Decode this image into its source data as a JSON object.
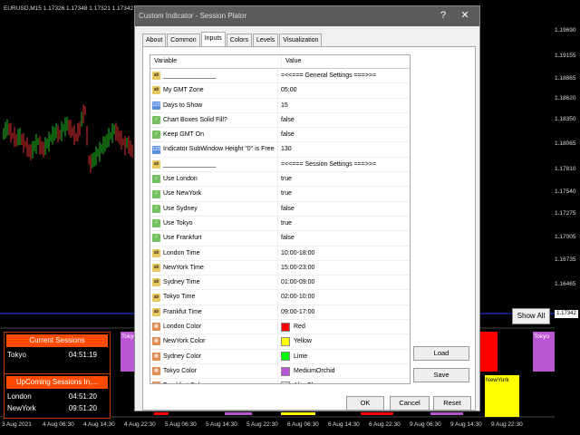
{
  "chart": {
    "symbol_info": "EURUSD,M15  1.17326 1.17348 1.17321 1.17342",
    "price_labels": [
      "1.19690",
      "1.19155",
      "1.18865",
      "1.18620",
      "1.18350",
      "1.18065",
      "1.17810",
      "1.17540",
      "1.17275",
      "1.17005",
      "1.16735",
      "1.16465"
    ],
    "current_price": "1.17342",
    "time_labels": [
      "3 Aug 2021",
      "4 Aug 06:30",
      "4 Aug 14:30",
      "4 Aug 22:30",
      "5 Aug 06:30",
      "5 Aug 14:30",
      "5 Aug 22:30",
      "6 Aug 06:30",
      "6 Aug 14:30",
      "6 Aug 22:30",
      "9 Aug 06:30",
      "9 Aug 14:30",
      "9 Aug 22:30"
    ],
    "show_all_label": "Show All",
    "tokyo_box_label": "Tokyo",
    "tokyo_box_label_right": "Tokyo",
    "newyork_box_label": "NewYork"
  },
  "sessions_panel": {
    "current_title": "Current Sessions",
    "current_rows": [
      {
        "name": "Tokyo",
        "time": "04:51:19"
      }
    ],
    "upcoming_title": "UpComing Sessions In,...",
    "upcoming_rows": [
      {
        "name": "London",
        "time": "04:51:20"
      },
      {
        "name": "NewYork",
        "time": "09:51:20"
      }
    ]
  },
  "dialog": {
    "title": "Custom Indicator - Session Plator",
    "help_btn": "?",
    "close_btn": "✕",
    "tabs": [
      "About",
      "Common",
      "Inputs",
      "Colors",
      "Levels",
      "Visualization"
    ],
    "active_tab": "Inputs",
    "columns": {
      "variable": "Variable",
      "value": "Value"
    },
    "rows": [
      {
        "icon": "ab",
        "var": "_______________",
        "val": "=<<=== General Settings ===>>="
      },
      {
        "icon": "ab",
        "var": "My GMT Zone",
        "val": "05:00"
      },
      {
        "icon": "num",
        "var": "Days to Show",
        "val": "15"
      },
      {
        "icon": "bool",
        "var": "Chart Boxes Solid Fill?",
        "val": "false"
      },
      {
        "icon": "bool",
        "var": "Keep GMT On",
        "val": "false"
      },
      {
        "icon": "num",
        "var": "Indicator SubWindow Height \"0\" is Free",
        "val": "130"
      },
      {
        "icon": "ab",
        "var": "_______________",
        "val": "=<<=== Session Settings ===>>="
      },
      {
        "icon": "bool",
        "var": "Use London",
        "val": "true"
      },
      {
        "icon": "bool",
        "var": "Use NewYork",
        "val": "true"
      },
      {
        "icon": "bool",
        "var": "Use Sydney",
        "val": "false"
      },
      {
        "icon": "bool",
        "var": "Use Tokyo",
        "val": "true"
      },
      {
        "icon": "bool",
        "var": "Use Frankfurt",
        "val": "false"
      },
      {
        "icon": "ab",
        "var": "London Time",
        "val": "10:00-18:00"
      },
      {
        "icon": "ab",
        "var": "NewYork Time",
        "val": "15:00-23:00"
      },
      {
        "icon": "ab",
        "var": "Sydney Time",
        "val": "01:00-09:00"
      },
      {
        "icon": "ab",
        "var": "Tokyo Time",
        "val": "02:00-10:00"
      },
      {
        "icon": "ab",
        "var": "Frankfut Time",
        "val": "09:00-17:00"
      },
      {
        "icon": "col",
        "var": "London Color",
        "val": "Red",
        "color": "#ff0000"
      },
      {
        "icon": "col",
        "var": "NewYork Color",
        "val": "Yellow",
        "color": "#ffff00"
      },
      {
        "icon": "col",
        "var": "Sydney Color",
        "val": "Lime",
        "color": "#00ff00"
      },
      {
        "icon": "col",
        "var": "Tokyo Color",
        "val": "MediumOrchid",
        "color": "#ba55d3"
      },
      {
        "icon": "col",
        "var": "Frankfurt Color",
        "val": "AliceBlue",
        "color": "#f0f8ff"
      }
    ],
    "icon_text": {
      "ab": "ab",
      "num": "123",
      "bool": "✓",
      "col": "▦"
    },
    "load_btn": "Load",
    "save_btn": "Save",
    "ok_btn": "OK",
    "cancel_btn": "Cancel",
    "reset_btn": "Reset"
  }
}
